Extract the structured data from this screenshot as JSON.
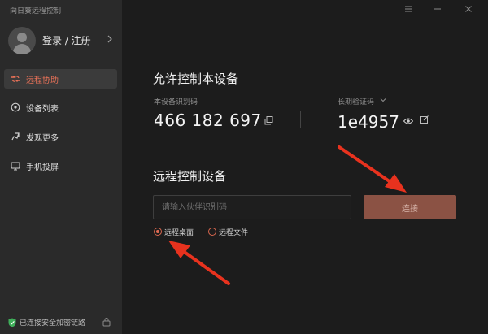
{
  "app": {
    "title": "向日葵远程控制"
  },
  "account": {
    "login_label": "登录 / 注册"
  },
  "sidebar": {
    "items": [
      {
        "label": "远程协助",
        "icon": "remote-assist-icon",
        "active": true
      },
      {
        "label": "设备列表",
        "icon": "device-list-icon",
        "active": false
      },
      {
        "label": "发现更多",
        "icon": "discover-icon",
        "active": false
      },
      {
        "label": "手机投屏",
        "icon": "screen-cast-icon",
        "active": false
      }
    ]
  },
  "status": {
    "text": "已连接安全加密链路"
  },
  "allow": {
    "title": "允许控制本设备",
    "id_label": "本设备识别码",
    "id_value": "466 182 697",
    "code_label": "长期验证码",
    "code_value": "1e4957"
  },
  "control": {
    "title": "远程控制设备",
    "input_placeholder": "请输入伙伴识别码",
    "connect_label": "连接",
    "modes": [
      {
        "label": "远程桌面",
        "checked": true
      },
      {
        "label": "远程文件",
        "checked": false
      }
    ]
  },
  "colors": {
    "accent": "#ea7258",
    "connect_button": "#8b5244",
    "annotation_arrow": "#e8321e"
  }
}
